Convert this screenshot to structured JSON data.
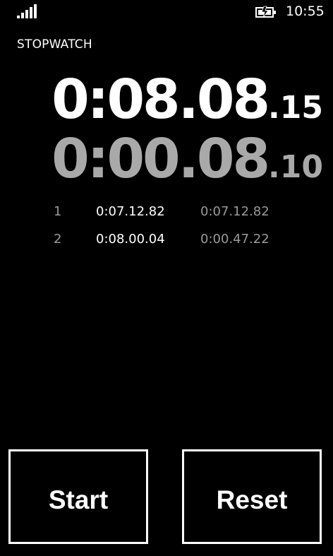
{
  "status_bar": {
    "signal_icon": "signal-strength-icon",
    "battery_icon": "battery-charging-icon",
    "time": "10:55"
  },
  "app": {
    "title": "STOPWATCH"
  },
  "timers": {
    "total": {
      "main": "0:08.08",
      "fraction": ".15"
    },
    "lap": {
      "main": "0:00.08",
      "fraction": ".10"
    }
  },
  "laps": [
    {
      "index": "1",
      "total": "0:07.12.82",
      "split": "0:07.12.82"
    },
    {
      "index": "2",
      "total": "0:08.00.04",
      "split": "0:00.47.22"
    }
  ],
  "buttons": {
    "start": "Start",
    "reset": "Reset"
  },
  "colors": {
    "background": "#000000",
    "primary_text": "#ffffff",
    "secondary_text": "#a9a9a9"
  }
}
